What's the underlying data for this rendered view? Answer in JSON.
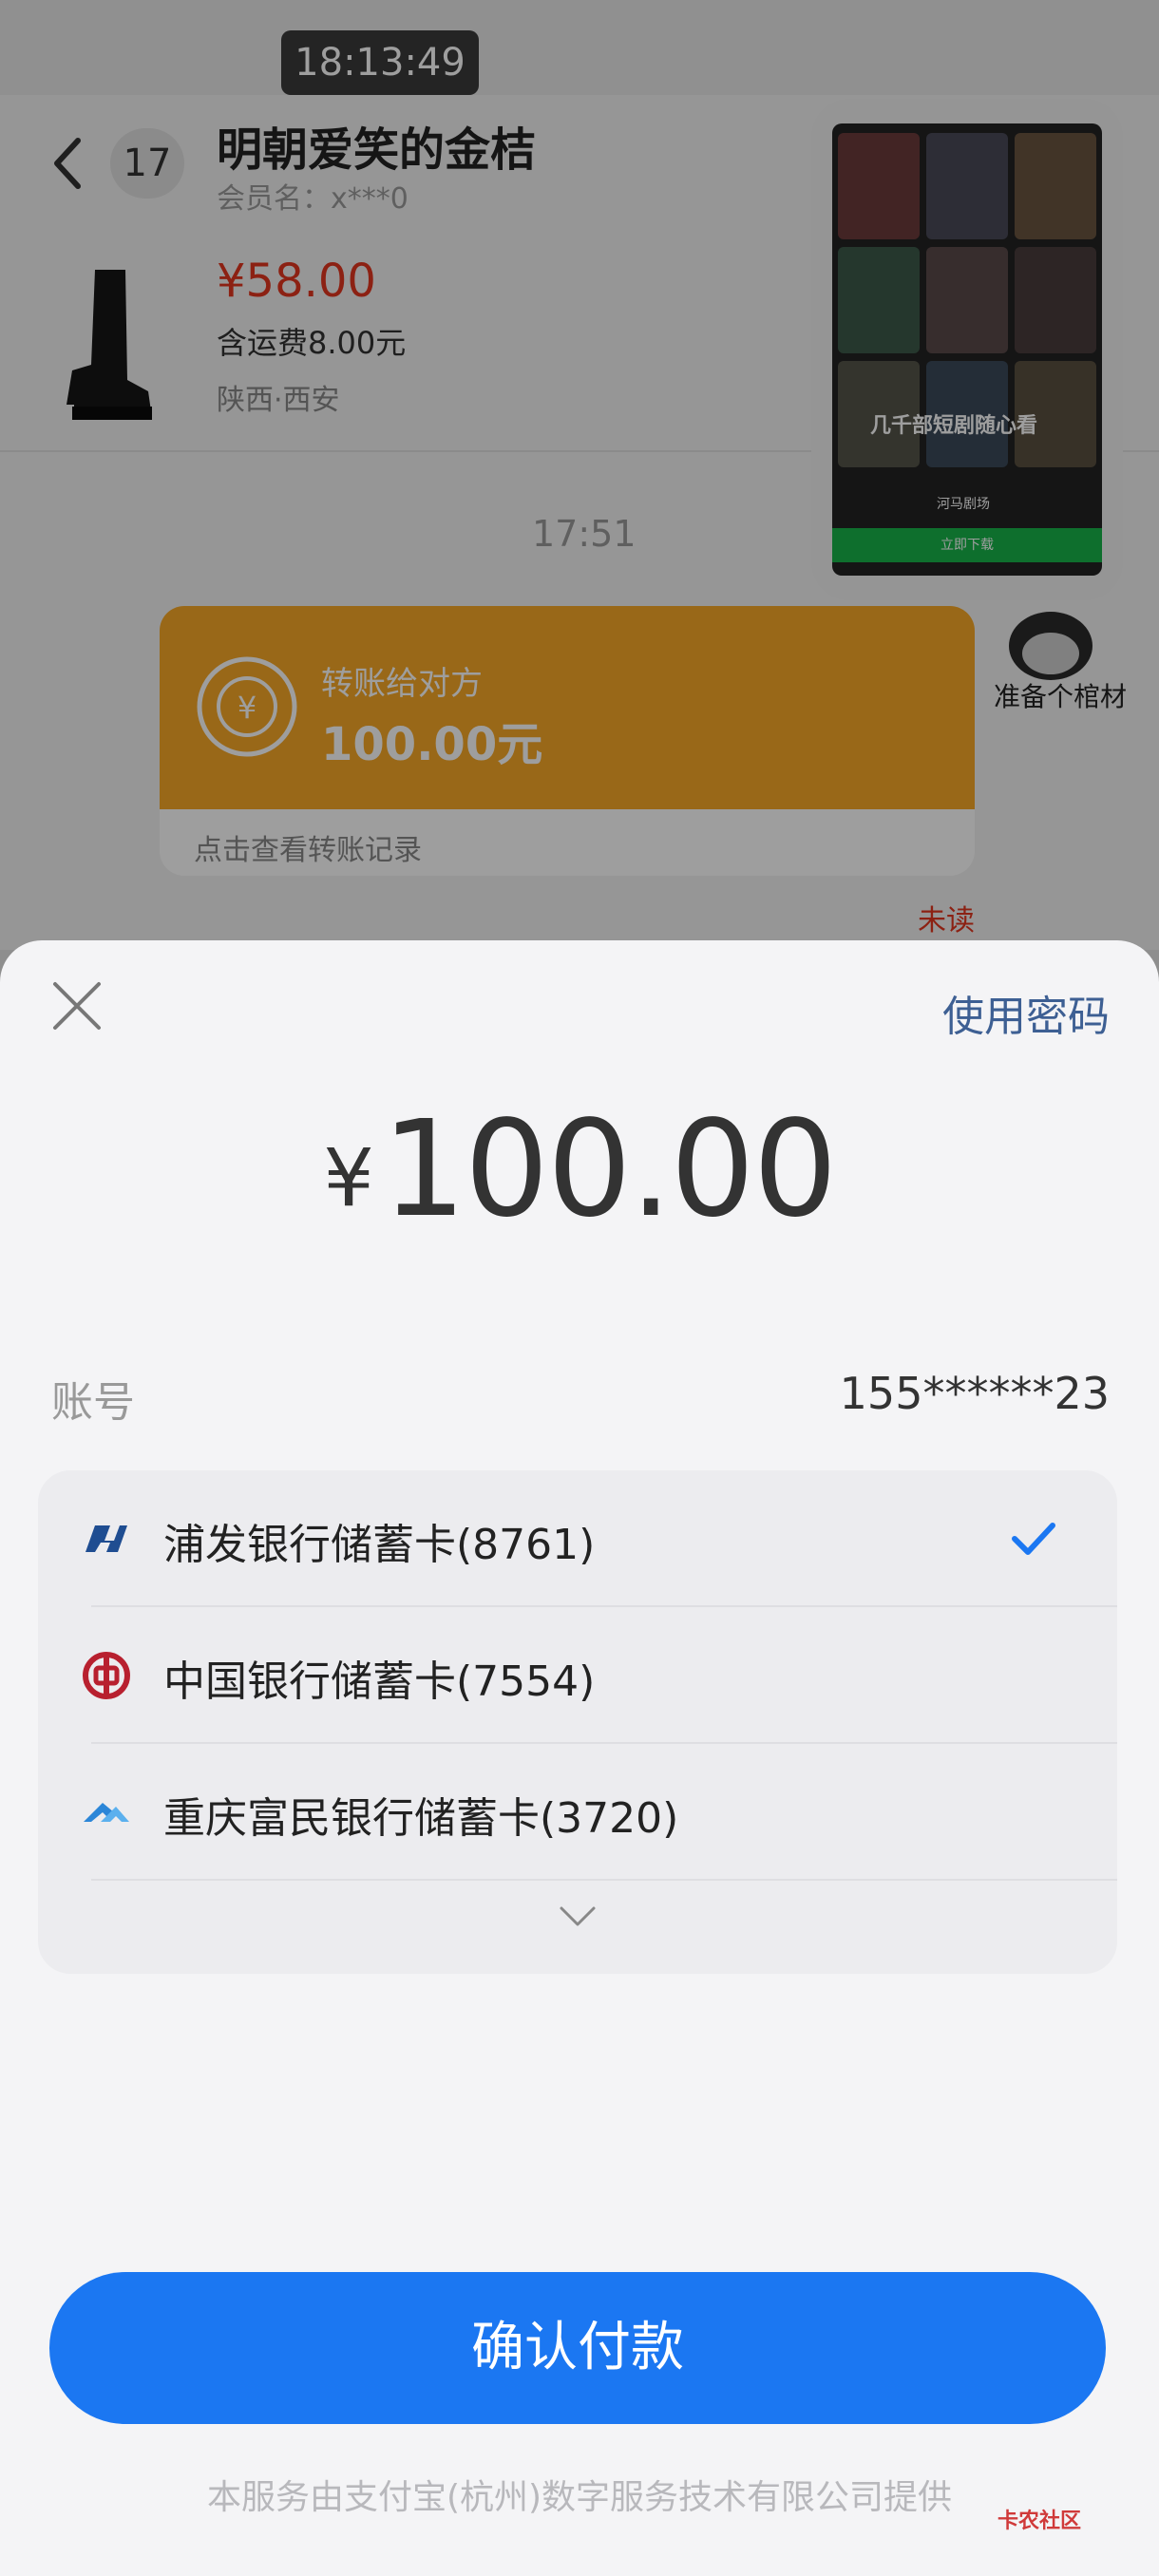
{
  "status_bar": {
    "time": "18:13:49"
  },
  "chat": {
    "unread_count": "17",
    "seller_name": "明朝爱笑的金桔",
    "member_name": "会员名：x***0",
    "product": {
      "price": "¥58.00",
      "shipping": "含运费8.00元",
      "location": "陕西·西安"
    },
    "message_time": "17:51",
    "transfer": {
      "title": "转账给对方",
      "amount": "100.00元",
      "record_link": "点击查看转账记录"
    },
    "sender_avatar_caption": "准备个棺材",
    "unread_label": "未读"
  },
  "pip_video": {
    "center_text": "几千部短剧随心看",
    "brand": "河马剧场",
    "download_label": "立即下载"
  },
  "payment": {
    "use_password_label": "使用密码",
    "currency_symbol": "¥",
    "amount": "100.00",
    "account_label": "账号",
    "account_value": "155******23",
    "banks": [
      {
        "name": "浦发银行储蓄卡(8761)",
        "icon": "spdb-bank-icon",
        "selected": true,
        "color": "#1f4d91"
      },
      {
        "name": "中国银行储蓄卡(7554)",
        "icon": "boc-bank-icon",
        "selected": false,
        "color": "#b8202f"
      },
      {
        "name": "重庆富民银行储蓄卡(3720)",
        "icon": "fumin-bank-icon",
        "selected": false,
        "color": "#2b86d8"
      }
    ],
    "confirm_label": "确认付款",
    "footer_note": "本服务由支付宝(杭州)数字服务技术有限公司提供",
    "accent_color": "#1b77f2"
  },
  "watermark": "卡农社区"
}
